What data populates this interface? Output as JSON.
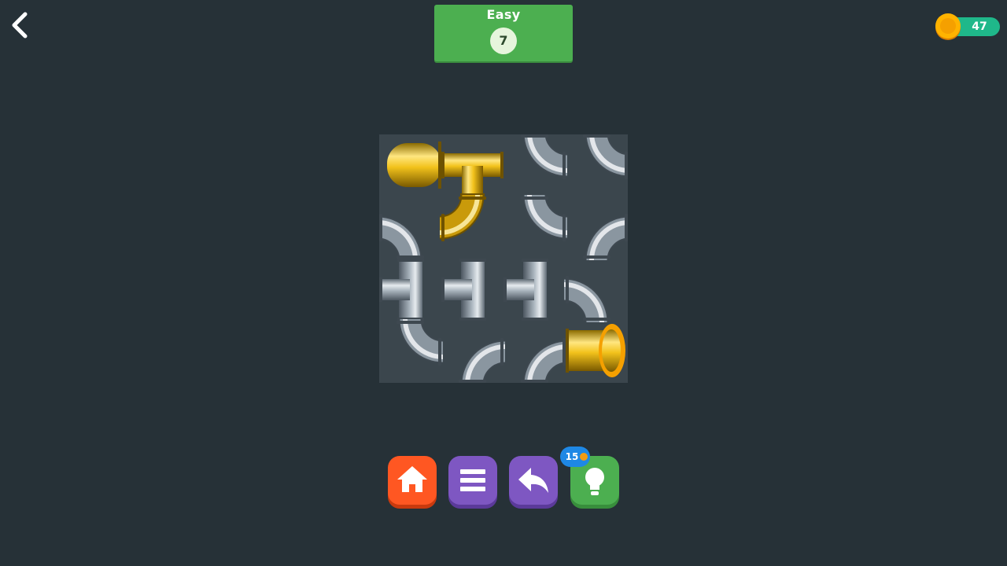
{
  "header": {
    "difficulty": "Easy",
    "level": "7",
    "coins": "47"
  },
  "toolbar": {
    "hint_count": "15"
  },
  "colors": {
    "background": "#263137",
    "level_card": "#4caf50",
    "coin_pill": "#1fb88a",
    "coin": "#ffb300",
    "home_button": "#ff5722",
    "menu_button": "#7e57c2",
    "undo_button": "#7e57c2",
    "hint_button": "#4caf50",
    "hint_badge": "#1e88e5",
    "pipe_silver": "#9aa6b1",
    "pipe_gold": "#f2c21b"
  },
  "board": {
    "rows": 4,
    "cols": 4,
    "tiles": [
      {
        "row": 0,
        "col": 0,
        "kind": "source-end",
        "color": "gold",
        "icon": "pipe-end-source-icon"
      },
      {
        "row": 0,
        "col": 1,
        "kind": "tee",
        "color": "gold",
        "icon": "pipe-tee-icon"
      },
      {
        "row": 0,
        "col": 2,
        "kind": "elbow",
        "color": "silver",
        "icon": "pipe-elbow-icon"
      },
      {
        "row": 0,
        "col": 3,
        "kind": "elbow",
        "color": "silver",
        "icon": "pipe-elbow-icon"
      },
      {
        "row": 1,
        "col": 0,
        "kind": "elbow",
        "color": "silver",
        "icon": "pipe-elbow-icon"
      },
      {
        "row": 1,
        "col": 1,
        "kind": "elbow",
        "color": "gold",
        "icon": "pipe-elbow-icon"
      },
      {
        "row": 1,
        "col": 2,
        "kind": "elbow",
        "color": "silver",
        "icon": "pipe-elbow-icon"
      },
      {
        "row": 1,
        "col": 3,
        "kind": "elbow",
        "color": "silver",
        "icon": "pipe-elbow-icon"
      },
      {
        "row": 2,
        "col": 0,
        "kind": "tee",
        "color": "silver",
        "icon": "pipe-tee-icon"
      },
      {
        "row": 2,
        "col": 1,
        "kind": "tee",
        "color": "silver",
        "icon": "pipe-tee-icon"
      },
      {
        "row": 2,
        "col": 2,
        "kind": "tee",
        "color": "silver",
        "icon": "pipe-tee-icon"
      },
      {
        "row": 2,
        "col": 3,
        "kind": "elbow",
        "color": "silver",
        "icon": "pipe-elbow-icon"
      },
      {
        "row": 3,
        "col": 0,
        "kind": "elbow",
        "color": "silver",
        "icon": "pipe-elbow-icon"
      },
      {
        "row": 3,
        "col": 1,
        "kind": "elbow",
        "color": "silver",
        "icon": "pipe-elbow-icon"
      },
      {
        "row": 3,
        "col": 2,
        "kind": "elbow",
        "color": "silver",
        "icon": "pipe-elbow-icon"
      },
      {
        "row": 3,
        "col": 3,
        "kind": "sink-end",
        "color": "gold",
        "icon": "pipe-end-sink-icon"
      }
    ]
  },
  "icons": {
    "back": "chevron-left-icon",
    "coin": "coin-icon",
    "home": "home-icon",
    "menu": "menu-icon",
    "undo": "undo-icon",
    "hint": "lightbulb-icon"
  }
}
